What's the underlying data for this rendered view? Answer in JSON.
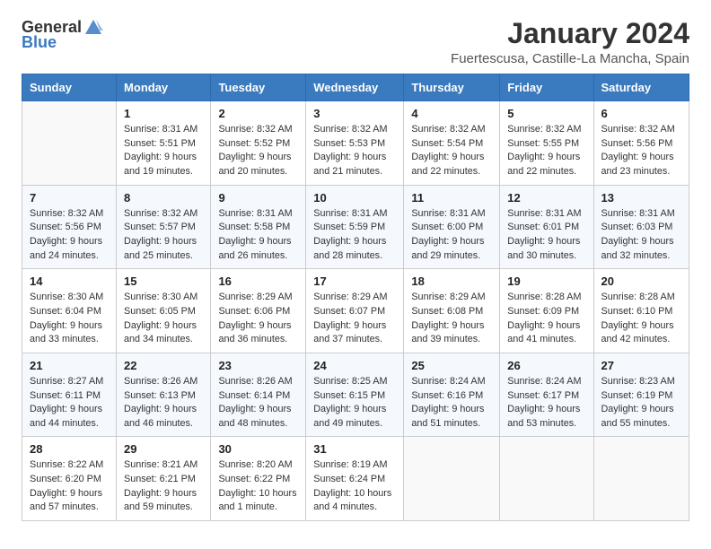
{
  "header": {
    "logo_general": "General",
    "logo_blue": "Blue",
    "title": "January 2024",
    "subtitle": "Fuertescusa, Castille-La Mancha, Spain"
  },
  "days_of_week": [
    "Sunday",
    "Monday",
    "Tuesday",
    "Wednesday",
    "Thursday",
    "Friday",
    "Saturday"
  ],
  "weeks": [
    [
      {
        "num": "",
        "sunrise": "",
        "sunset": "",
        "daylight": ""
      },
      {
        "num": "1",
        "sunrise": "Sunrise: 8:31 AM",
        "sunset": "Sunset: 5:51 PM",
        "daylight": "Daylight: 9 hours and 19 minutes."
      },
      {
        "num": "2",
        "sunrise": "Sunrise: 8:32 AM",
        "sunset": "Sunset: 5:52 PM",
        "daylight": "Daylight: 9 hours and 20 minutes."
      },
      {
        "num": "3",
        "sunrise": "Sunrise: 8:32 AM",
        "sunset": "Sunset: 5:53 PM",
        "daylight": "Daylight: 9 hours and 21 minutes."
      },
      {
        "num": "4",
        "sunrise": "Sunrise: 8:32 AM",
        "sunset": "Sunset: 5:54 PM",
        "daylight": "Daylight: 9 hours and 22 minutes."
      },
      {
        "num": "5",
        "sunrise": "Sunrise: 8:32 AM",
        "sunset": "Sunset: 5:55 PM",
        "daylight": "Daylight: 9 hours and 22 minutes."
      },
      {
        "num": "6",
        "sunrise": "Sunrise: 8:32 AM",
        "sunset": "Sunset: 5:56 PM",
        "daylight": "Daylight: 9 hours and 23 minutes."
      }
    ],
    [
      {
        "num": "7",
        "sunrise": "Sunrise: 8:32 AM",
        "sunset": "Sunset: 5:56 PM",
        "daylight": "Daylight: 9 hours and 24 minutes."
      },
      {
        "num": "8",
        "sunrise": "Sunrise: 8:32 AM",
        "sunset": "Sunset: 5:57 PM",
        "daylight": "Daylight: 9 hours and 25 minutes."
      },
      {
        "num": "9",
        "sunrise": "Sunrise: 8:31 AM",
        "sunset": "Sunset: 5:58 PM",
        "daylight": "Daylight: 9 hours and 26 minutes."
      },
      {
        "num": "10",
        "sunrise": "Sunrise: 8:31 AM",
        "sunset": "Sunset: 5:59 PM",
        "daylight": "Daylight: 9 hours and 28 minutes."
      },
      {
        "num": "11",
        "sunrise": "Sunrise: 8:31 AM",
        "sunset": "Sunset: 6:00 PM",
        "daylight": "Daylight: 9 hours and 29 minutes."
      },
      {
        "num": "12",
        "sunrise": "Sunrise: 8:31 AM",
        "sunset": "Sunset: 6:01 PM",
        "daylight": "Daylight: 9 hours and 30 minutes."
      },
      {
        "num": "13",
        "sunrise": "Sunrise: 8:31 AM",
        "sunset": "Sunset: 6:03 PM",
        "daylight": "Daylight: 9 hours and 32 minutes."
      }
    ],
    [
      {
        "num": "14",
        "sunrise": "Sunrise: 8:30 AM",
        "sunset": "Sunset: 6:04 PM",
        "daylight": "Daylight: 9 hours and 33 minutes."
      },
      {
        "num": "15",
        "sunrise": "Sunrise: 8:30 AM",
        "sunset": "Sunset: 6:05 PM",
        "daylight": "Daylight: 9 hours and 34 minutes."
      },
      {
        "num": "16",
        "sunrise": "Sunrise: 8:29 AM",
        "sunset": "Sunset: 6:06 PM",
        "daylight": "Daylight: 9 hours and 36 minutes."
      },
      {
        "num": "17",
        "sunrise": "Sunrise: 8:29 AM",
        "sunset": "Sunset: 6:07 PM",
        "daylight": "Daylight: 9 hours and 37 minutes."
      },
      {
        "num": "18",
        "sunrise": "Sunrise: 8:29 AM",
        "sunset": "Sunset: 6:08 PM",
        "daylight": "Daylight: 9 hours and 39 minutes."
      },
      {
        "num": "19",
        "sunrise": "Sunrise: 8:28 AM",
        "sunset": "Sunset: 6:09 PM",
        "daylight": "Daylight: 9 hours and 41 minutes."
      },
      {
        "num": "20",
        "sunrise": "Sunrise: 8:28 AM",
        "sunset": "Sunset: 6:10 PM",
        "daylight": "Daylight: 9 hours and 42 minutes."
      }
    ],
    [
      {
        "num": "21",
        "sunrise": "Sunrise: 8:27 AM",
        "sunset": "Sunset: 6:11 PM",
        "daylight": "Daylight: 9 hours and 44 minutes."
      },
      {
        "num": "22",
        "sunrise": "Sunrise: 8:26 AM",
        "sunset": "Sunset: 6:13 PM",
        "daylight": "Daylight: 9 hours and 46 minutes."
      },
      {
        "num": "23",
        "sunrise": "Sunrise: 8:26 AM",
        "sunset": "Sunset: 6:14 PM",
        "daylight": "Daylight: 9 hours and 48 minutes."
      },
      {
        "num": "24",
        "sunrise": "Sunrise: 8:25 AM",
        "sunset": "Sunset: 6:15 PM",
        "daylight": "Daylight: 9 hours and 49 minutes."
      },
      {
        "num": "25",
        "sunrise": "Sunrise: 8:24 AM",
        "sunset": "Sunset: 6:16 PM",
        "daylight": "Daylight: 9 hours and 51 minutes."
      },
      {
        "num": "26",
        "sunrise": "Sunrise: 8:24 AM",
        "sunset": "Sunset: 6:17 PM",
        "daylight": "Daylight: 9 hours and 53 minutes."
      },
      {
        "num": "27",
        "sunrise": "Sunrise: 8:23 AM",
        "sunset": "Sunset: 6:19 PM",
        "daylight": "Daylight: 9 hours and 55 minutes."
      }
    ],
    [
      {
        "num": "28",
        "sunrise": "Sunrise: 8:22 AM",
        "sunset": "Sunset: 6:20 PM",
        "daylight": "Daylight: 9 hours and 57 minutes."
      },
      {
        "num": "29",
        "sunrise": "Sunrise: 8:21 AM",
        "sunset": "Sunset: 6:21 PM",
        "daylight": "Daylight: 9 hours and 59 minutes."
      },
      {
        "num": "30",
        "sunrise": "Sunrise: 8:20 AM",
        "sunset": "Sunset: 6:22 PM",
        "daylight": "Daylight: 10 hours and 1 minute."
      },
      {
        "num": "31",
        "sunrise": "Sunrise: 8:19 AM",
        "sunset": "Sunset: 6:24 PM",
        "daylight": "Daylight: 10 hours and 4 minutes."
      },
      {
        "num": "",
        "sunrise": "",
        "sunset": "",
        "daylight": ""
      },
      {
        "num": "",
        "sunrise": "",
        "sunset": "",
        "daylight": ""
      },
      {
        "num": "",
        "sunrise": "",
        "sunset": "",
        "daylight": ""
      }
    ]
  ]
}
